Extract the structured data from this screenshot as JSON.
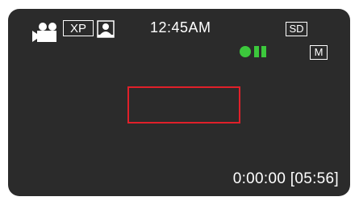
{
  "status_bar": {
    "quality": "XP",
    "clock": "12:45AM",
    "media": "SD",
    "mode": "M",
    "icons": {
      "record_mode": "video-camera-icon",
      "scene": "portrait-scene-icon",
      "battery": "battery-status-icon"
    },
    "battery_color": "#3cc83c"
  },
  "viewfinder": {
    "focus_frame_color": "#e0202a"
  },
  "footer": {
    "timecode": "0:00:00 [05:56]"
  }
}
